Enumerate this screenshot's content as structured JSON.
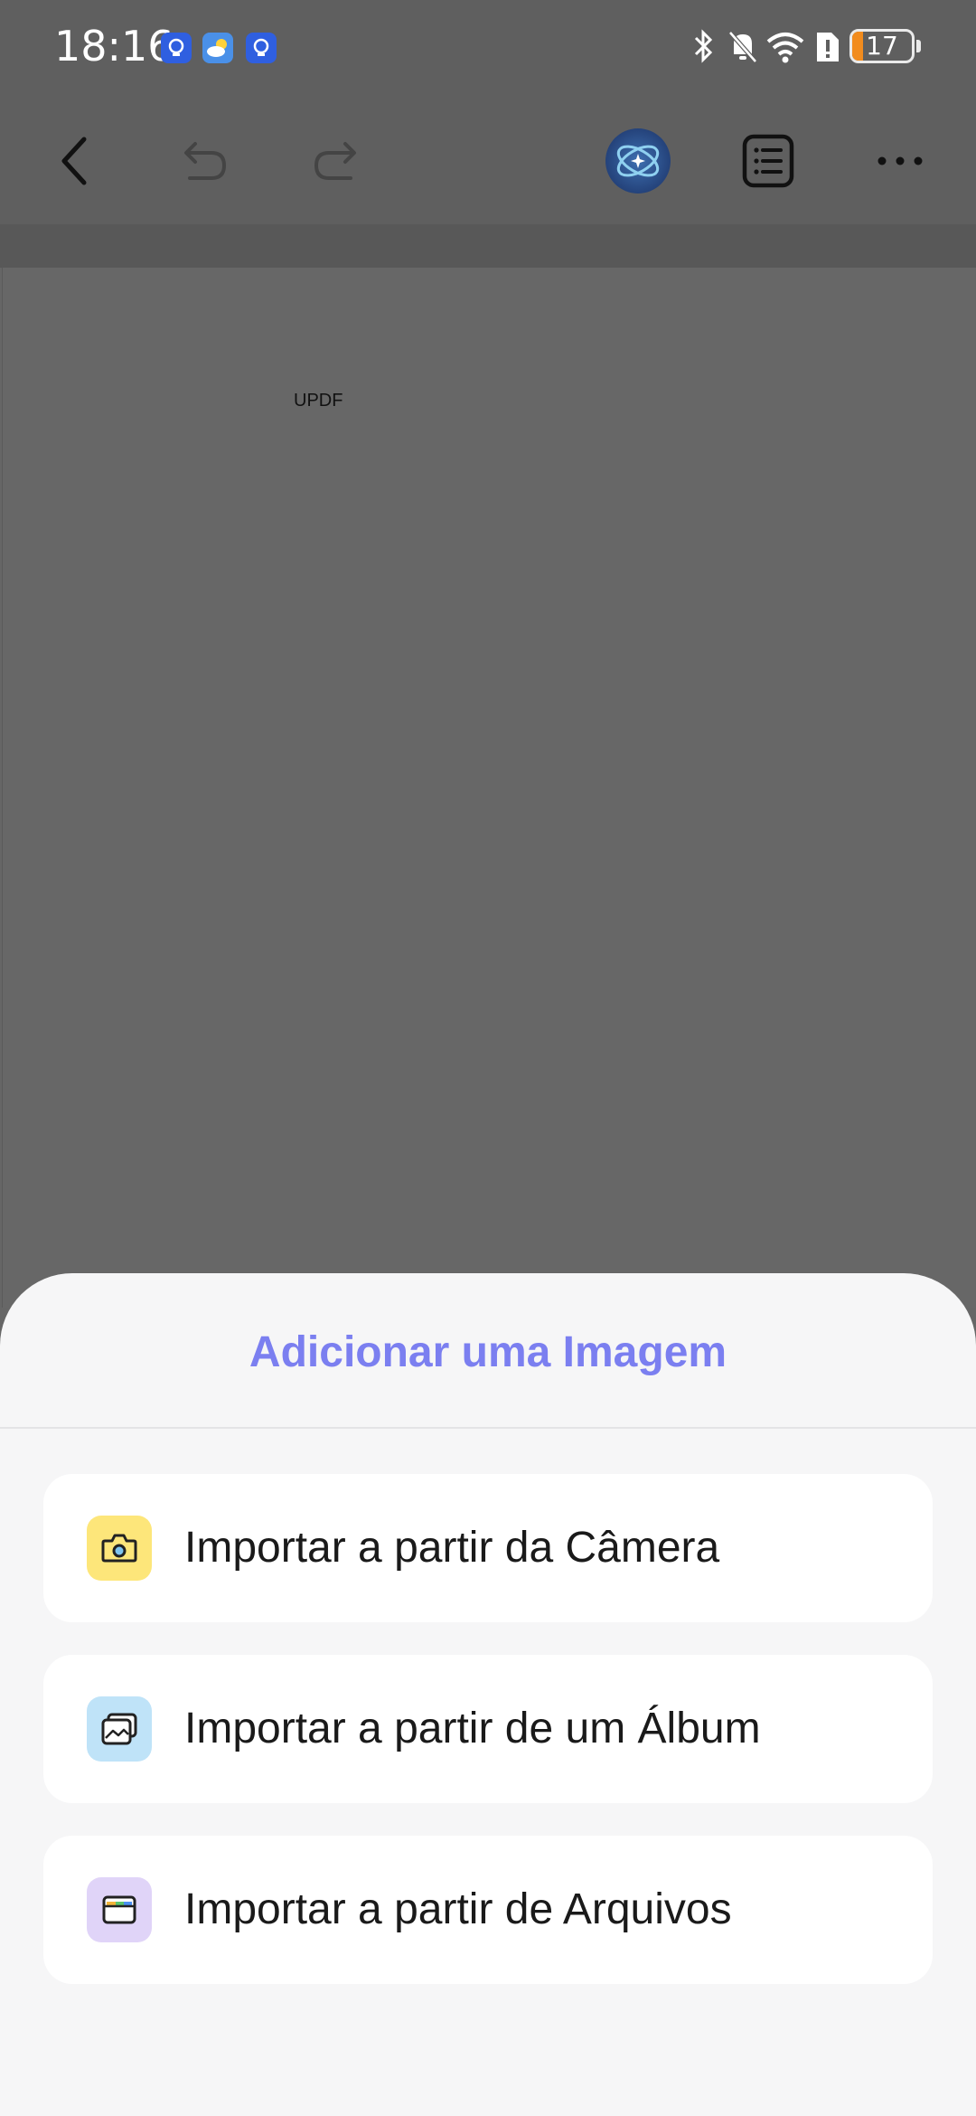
{
  "status_bar": {
    "time": "18:16",
    "battery_level": "17",
    "notification_icons": [
      "lightbulb-icon",
      "weather-icon",
      "lightbulb-icon"
    ],
    "system_icons": [
      "bluetooth-icon",
      "bell-muted-icon",
      "wifi-icon",
      "sim-alert-icon",
      "battery-icon"
    ]
  },
  "toolbar": {
    "icons": [
      "back-icon",
      "undo-icon",
      "redo-icon",
      "ai-assistant-icon",
      "outline-list-icon",
      "more-icon"
    ]
  },
  "document": {
    "text": "UPDF"
  },
  "sheet": {
    "title": "Adicionar uma Imagem",
    "title_color": "#7b7ff0",
    "options": [
      {
        "label": "Importar a partir da Câmera",
        "icon": "camera-icon",
        "icon_bg": "#fde67a"
      },
      {
        "label": "Importar a partir de um Álbum",
        "icon": "album-icon",
        "icon_bg": "#bfe3f8"
      },
      {
        "label": "Importar a partir de Arquivos",
        "icon": "files-icon",
        "icon_bg": "#e0d4f8"
      }
    ]
  }
}
